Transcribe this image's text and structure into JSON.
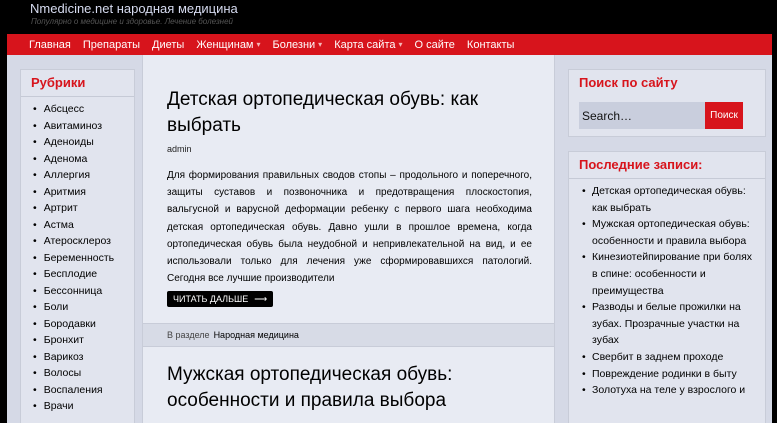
{
  "site": {
    "title": "Nmedicine.net народная медицина",
    "description": "Популярно о медицине и здоровье. Лечение болезней"
  },
  "nav": [
    {
      "label": "Главная",
      "dropdown": false
    },
    {
      "label": "Препараты",
      "dropdown": false
    },
    {
      "label": "Диеты",
      "dropdown": false
    },
    {
      "label": "Женщинам",
      "dropdown": true
    },
    {
      "label": "Болезни",
      "dropdown": true
    },
    {
      "label": "Карта сайта",
      "dropdown": true
    },
    {
      "label": "О сайте",
      "dropdown": false
    },
    {
      "label": "Контакты",
      "dropdown": false
    }
  ],
  "left_sidebar": {
    "title": "Рубрики",
    "items": [
      "Абсцесс",
      "Авитаминоз",
      "Аденоиды",
      "Аденома",
      "Аллергия",
      "Аритмия",
      "Артрит",
      "Астма",
      "Атеросклероз",
      "Беременность",
      "Бесплодие",
      "Бессонница",
      "Боли",
      "Бородавки",
      "Бронхит",
      "Варикоз",
      "Волосы",
      "Воспаления",
      "Врачи"
    ]
  },
  "posts": [
    {
      "title": "Детская ортопедическая обувь: как выбрать",
      "author": "admin",
      "excerpt": "Для формирования правильных сводов стопы – продольного и поперечного, защиты суставов и позвоночника и предотвращения плоскостопия, вальгусной и варусной деформации ребенку с первого шага необходима детская ортопедическая обувь. Давно ушли в прошлое времена, когда ортопедическая обувь была неудобной и непривлекательной на вид, и ее использовали только для лечения уже сформировавшихся патологий. Сегодня все лучшие производители",
      "read_more": "ЧИТАТЬ ДАЛЬШЕ",
      "category_label": "В разделе",
      "category": "Народная медицина"
    },
    {
      "title": "Мужская ортопедическая обувь: особенности и правила выбора"
    }
  ],
  "search": {
    "title": "Поиск по сайту",
    "placeholder": "Search…",
    "button": "Поиск"
  },
  "recent": {
    "title": "Последние записи:",
    "items": [
      "Детская ортопедическая обувь: как выбрать",
      "Мужская ортопедическая обувь: особенности и правила выбора",
      "Кинезиотейпирование при болях в спине: особенности и преимущества",
      "Разводы и белые прожилки на зубах. Прозрачные участки на зубах",
      "Свербит в заднем проходе",
      "Повреждение родинки в быту",
      "Золотуха на теле у взрослого и"
    ]
  },
  "colors": {
    "accent": "#d7141c",
    "header_bg": "#000000",
    "page_bg": "#d5d9e6",
    "content_bg": "#e8ebf3"
  },
  "icons": {
    "nav_dropdown": "chevron-down-icon",
    "read_more": "arrow-right-icon"
  }
}
